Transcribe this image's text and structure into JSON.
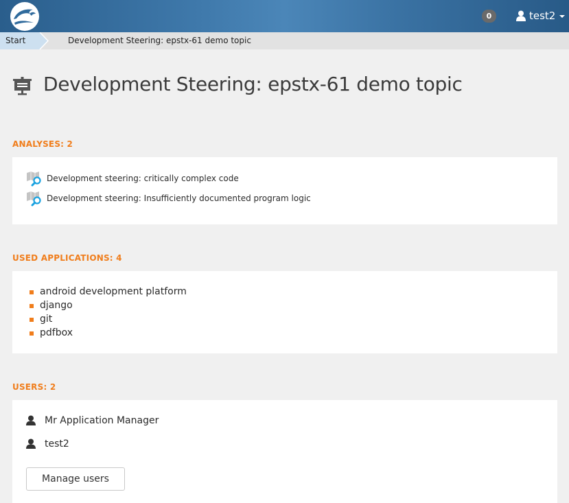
{
  "navbar": {
    "logo_icon": "bird-logo-icon",
    "notification_count": "0",
    "user_name": "test2",
    "colors": {
      "brand": "#3f79ab",
      "badge": "#6a6a6a"
    }
  },
  "breadcrumb": {
    "start_label": "Start",
    "current_label": "Development Steering: epstx-61 demo topic"
  },
  "page": {
    "title_icon": "presentation-board-icon",
    "title": "Development Steering: epstx-61 demo topic"
  },
  "analyses": {
    "heading": "ANALYSES: 2",
    "item_icon": "map-search-icon",
    "items": [
      {
        "label": "Development steering: critically complex code"
      },
      {
        "label": "Development steering: Insufficiently documented program logic"
      }
    ]
  },
  "applications": {
    "heading": "USED APPLICATIONS: 4",
    "items": [
      {
        "label": "android development platform"
      },
      {
        "label": "django"
      },
      {
        "label": "git"
      },
      {
        "label": "pdfbox"
      }
    ]
  },
  "users": {
    "heading": "USERS: 2",
    "item_icon": "user-icon",
    "items": [
      {
        "label": "Mr Application Manager"
      },
      {
        "label": "test2"
      }
    ],
    "manage_button_label": "Manage users"
  },
  "colors": {
    "accent": "#f07d1b",
    "background": "#f0f0f0",
    "panel": "#ffffff"
  }
}
